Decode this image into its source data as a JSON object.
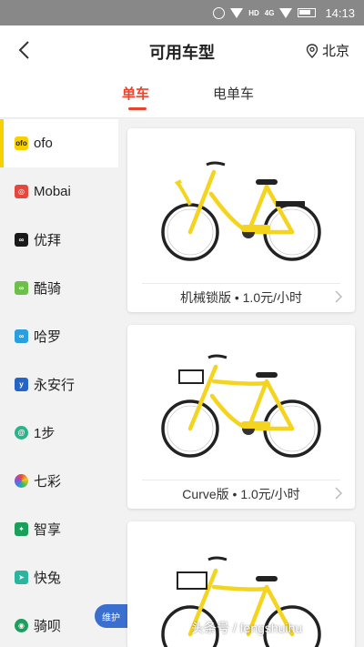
{
  "status_bar": {
    "time": "14:13",
    "network": "4G",
    "hd": "HD"
  },
  "header": {
    "title": "可用车型",
    "city": "北京"
  },
  "tabs": [
    {
      "label": "单车",
      "active": true
    },
    {
      "label": "电单车",
      "active": false
    }
  ],
  "sidebar": {
    "items": [
      {
        "label": "ofo",
        "icon": "ofo-logo-icon",
        "color": "#f7d000",
        "active": true
      },
      {
        "label": "Mobai",
        "icon": "mobai-logo-icon",
        "color": "#e5473c"
      },
      {
        "label": "优拜",
        "icon": "ubike-logo-icon",
        "color": "#1a1a1a"
      },
      {
        "label": "酷骑",
        "icon": "kuqi-logo-icon",
        "color": "#6cc04a"
      },
      {
        "label": "哈罗",
        "icon": "hello-logo-icon",
        "color": "#2a9fe0"
      },
      {
        "label": "永安行",
        "icon": "youon-logo-icon",
        "color": "#2464c6"
      },
      {
        "label": "1步",
        "icon": "yibu-logo-icon",
        "color": "#2bb38a"
      },
      {
        "label": "七彩",
        "icon": "qicai-logo-icon",
        "color": "#e86b4a"
      },
      {
        "label": "智享",
        "icon": "zhixiang-logo-icon",
        "color": "#1aa05a"
      },
      {
        "label": "快兔",
        "icon": "kuaitu-logo-icon",
        "color": "#2bb5a0"
      },
      {
        "label": "骑呗",
        "icon": "qibei-logo-icon",
        "color": "#1e9e5e"
      }
    ],
    "maintenance_badge": "维护"
  },
  "bikes": [
    {
      "label": "机械锁版 • 1.0元/小时"
    },
    {
      "label": "Curve版 • 1.0元/小时"
    },
    {
      "label": ""
    }
  ],
  "watermark": "头条号 / fengshuihu",
  "colors": {
    "accent": "#e8452f",
    "bike_yellow": "#f5d41f",
    "ofo_yellow": "#f7d000"
  }
}
